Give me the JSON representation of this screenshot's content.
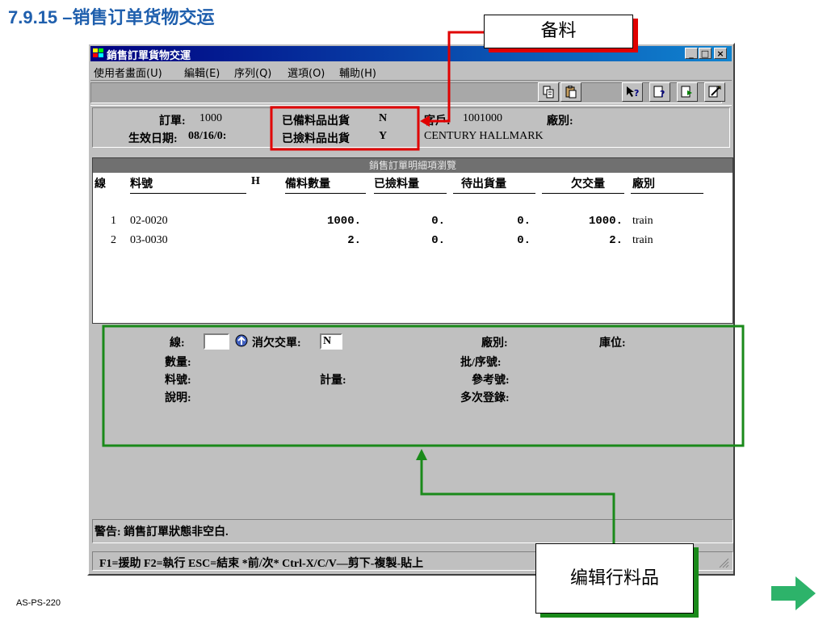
{
  "slide": {
    "title": "7.9.15 –销售订单货物交运",
    "footer_code": "AS-PS-220"
  },
  "window": {
    "title": "銷售訂單貨物交運",
    "minimize": "_",
    "maximize": "□",
    "close": "×"
  },
  "menu": [
    "使用者畫面(U)",
    "編輯(E)",
    "序列(Q)",
    "選項(O)",
    "輔助(H)"
  ],
  "toolbar": {
    "icons": [
      "copy-icon",
      "paste-icon",
      "help-icon",
      "query-icon",
      "export-icon",
      "run-icon"
    ]
  },
  "header": {
    "order_label": "訂單:",
    "order_value": "1000",
    "effective_date_label": "生效日期:",
    "effective_date_value": "08/16/0:",
    "prepared_shipment_label": "已備料品出貨",
    "prepared_shipment_value": "N",
    "picked_shipment_label": "已撿料品出貨",
    "picked_shipment_value": "Y",
    "customer_label": "客戶:",
    "customer_value": "1001000",
    "customer_name": "CENTURY HALLMARK",
    "site_label": "廠別:"
  },
  "grid": {
    "title": "銷售訂單明細項瀏覽",
    "columns": [
      "線",
      "料號",
      "H",
      "備料數量",
      "已撿料量",
      "待出貨量",
      "欠交量",
      "廠別"
    ],
    "rows": [
      {
        "line": "1",
        "item": "02-0020",
        "prepared": "1000.",
        "picked": "0.",
        "pending": "0.",
        "backorder": "1000.",
        "site": "train"
      },
      {
        "line": "2",
        "item": "03-0030",
        "prepared": "2.",
        "picked": "0.",
        "pending": "0.",
        "backorder": "2.",
        "site": "train"
      }
    ]
  },
  "detail": {
    "line_label": "線:",
    "line_value": "",
    "cancel_backorder_label": "消欠交單:",
    "cancel_backorder_value": "N",
    "site_label": "廠別:",
    "location_label": "庫位:",
    "quantity_label": "數量:",
    "lot_serial_label": "批/序號:",
    "item_label": "料號:",
    "um_label": "計量:",
    "reference_label": "參考號:",
    "description_label": "說明:",
    "multi_entry_label": "多次登錄:"
  },
  "warning": "警告: 銷售訂單狀態非空白.",
  "statusbar": "F1=援助 F2=執行 ESC=結束 *前/次* Ctrl-X/C/V—剪下-複製-貼上",
  "callouts": {
    "red": "备料",
    "green": "编辑行料品"
  },
  "colors": {
    "title_blue": "#1f5fad",
    "highlight_red": "#e00000",
    "highlight_green": "#1a8a1a",
    "next_arrow": "#2db36a",
    "window_gray": "#c0c0c0",
    "titlebar_navy": "#000080"
  }
}
